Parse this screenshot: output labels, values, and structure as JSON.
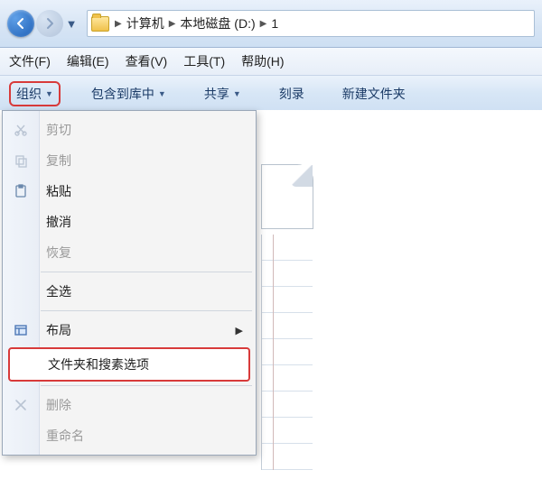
{
  "breadcrumb": {
    "sep": "▶",
    "items": [
      "计算机",
      "本地磁盘 (D:)",
      "1"
    ]
  },
  "menubar": {
    "file": "文件(F)",
    "edit": "编辑(E)",
    "view": "查看(V)",
    "tools": "工具(T)",
    "help": "帮助(H)"
  },
  "toolbar": {
    "organize": "组织",
    "include": "包含到库中",
    "share": "共享",
    "burn": "刻录",
    "new_folder": "新建文件夹",
    "drop_glyph": "▼"
  },
  "dropdown": {
    "cut": "剪切",
    "copy": "复制",
    "paste": "粘贴",
    "undo": "撤消",
    "redo": "恢复",
    "select_all": "全选",
    "layout": "布局",
    "folder_options": "文件夹和搜素选项",
    "delete": "删除",
    "rename": "重命名",
    "submenu_arrow": "▶"
  }
}
